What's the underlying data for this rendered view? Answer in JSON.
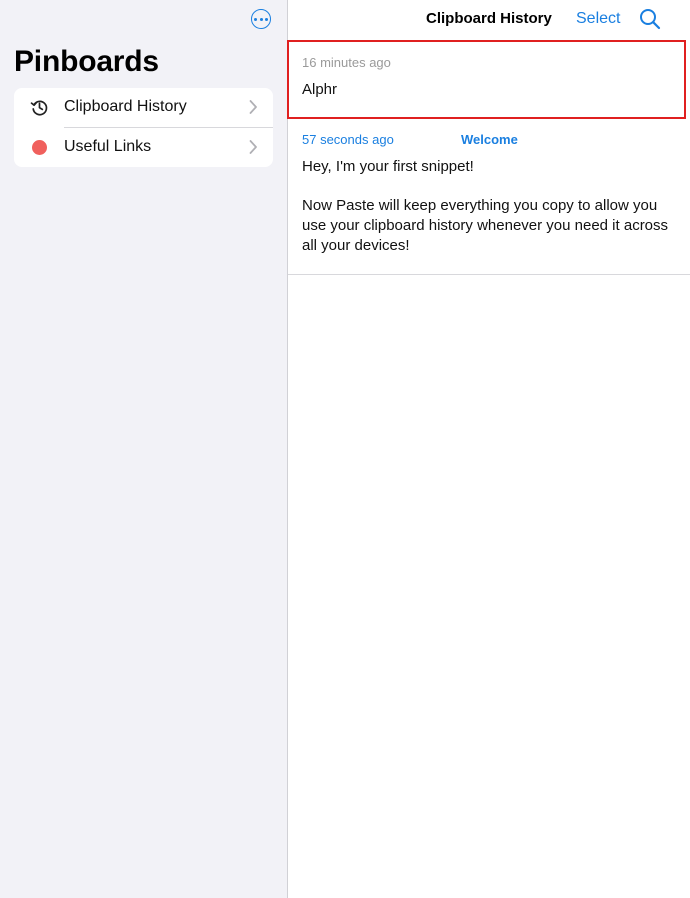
{
  "sidebar": {
    "title": "Pinboards",
    "more_icon": "more-ellipsis-circle-icon",
    "items": [
      {
        "label": "Clipboard History",
        "icon": "clock-history-icon"
      },
      {
        "label": "Useful Links",
        "icon": "red-dot-icon",
        "color": "#f0605d"
      }
    ]
  },
  "header": {
    "title": "Clipboard History",
    "select_label": "Select",
    "search_icon": "search-icon"
  },
  "clips": [
    {
      "time": "16 minutes ago",
      "text": "Alphr",
      "highlighted": true
    },
    {
      "time": "57 seconds ago",
      "tag": "Welcome",
      "paragraphs": [
        "Hey, I'm your first snippet!",
        "Now Paste will keep everything you copy to allow you use your clipboard history whenever you need it across all your devices!"
      ]
    }
  ],
  "colors": {
    "accent": "#1a7fe0",
    "highlight_border": "#e02020",
    "sidebar_bg": "#f2f2f7"
  }
}
